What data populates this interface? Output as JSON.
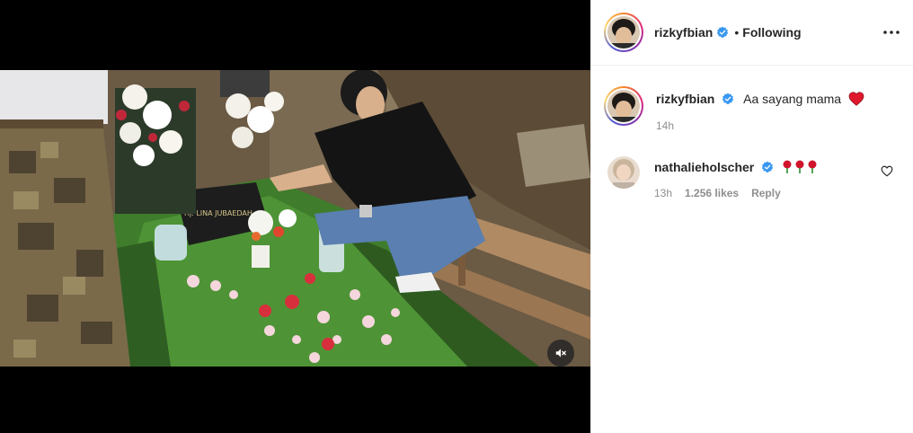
{
  "post": {
    "author": "rizkyfbian",
    "follow_separator": "•",
    "follow_status": "Following"
  },
  "caption": {
    "username": "rizkyfbian",
    "text": "Aa sayang mama",
    "emoji": "red-heart",
    "time": "14h"
  },
  "comments": [
    {
      "username": "nathalieholscher",
      "emoji": "three-red-roses",
      "time": "13h",
      "likes": "1.256 likes",
      "reply": "Reply"
    }
  ],
  "icons": {
    "verified": "verified-badge-icon",
    "more": "more-options-icon",
    "mute": "muted-speaker-icon",
    "like": "heart-outline-icon"
  },
  "colors": {
    "verified_blue": "#3897f0",
    "text": "#262626",
    "muted": "#8e8e8e"
  }
}
